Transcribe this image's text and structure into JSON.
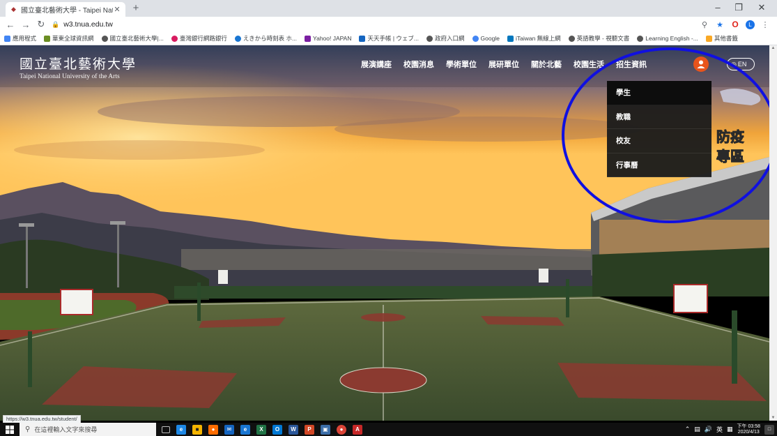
{
  "browser": {
    "tab_title": "國立臺北藝術大學 - Taipei Natio",
    "url": "w3.tnua.edu.tw",
    "bookmarks": [
      "應用程式",
      "華東全球資訊網",
      "國立臺北藝術大學|...",
      "臺灣銀行網路銀行",
      "えきから時刻表 ホ...",
      "Yahoo! JAPAN",
      "天天手帳 | ウェブ...",
      "政府入口網",
      "Google",
      "iTaiwan 無線上網",
      "英語教學 - 視聽文書",
      "Learning English -...",
      "其他書籤"
    ],
    "status_url": "https://w3.tnua.edu.tw/student/"
  },
  "site": {
    "logo_zh": "國立臺北藝術大學",
    "logo_en": "Taipei National University of the Arts",
    "nav": [
      "展演講座",
      "校園消息",
      "學術單位",
      "展研單位",
      "關於北藝",
      "校園生活",
      "招生資訊"
    ],
    "lang_label": "EN",
    "dropdown": [
      "學生",
      "教職",
      "校友",
      "行事曆"
    ],
    "banner_lines": [
      "防疫",
      "專區"
    ]
  },
  "taskbar": {
    "search_placeholder": "在這裡輸入文字來搜尋",
    "ime_label": "英",
    "time": "下午 03:58",
    "date": "2020/4/13"
  },
  "colors": {
    "accent_orange": "#e8541c",
    "annotation_blue": "#1010e0",
    "dropdown_bg": "#1c1c1c"
  }
}
